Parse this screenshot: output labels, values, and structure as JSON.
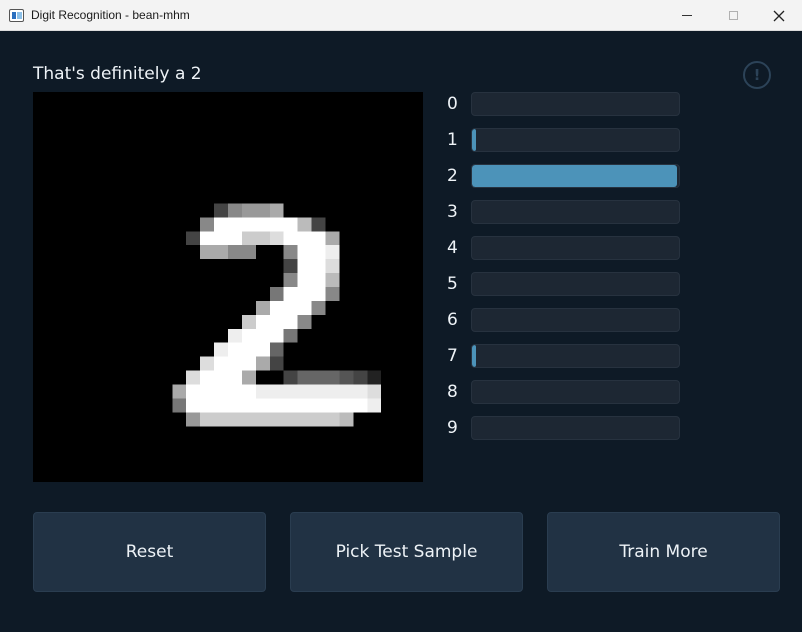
{
  "window": {
    "title": "Digit Recognition - bean-mhm",
    "controls": [
      "minimize-icon",
      "maximize-icon",
      "close-icon"
    ]
  },
  "prediction": {
    "headline": "That's definitely a 2",
    "info_icon": "!"
  },
  "probabilities": [
    {
      "digit": "0",
      "value": 0.0
    },
    {
      "digit": "1",
      "value": 0.01
    },
    {
      "digit": "2",
      "value": 0.99
    },
    {
      "digit": "3",
      "value": 0.0
    },
    {
      "digit": "4",
      "value": 0.0
    },
    {
      "digit": "5",
      "value": 0.0
    },
    {
      "digit": "6",
      "value": 0.0
    },
    {
      "digit": "7",
      "value": 0.01
    },
    {
      "digit": "8",
      "value": 0.0
    },
    {
      "digit": "9",
      "value": 0.0
    }
  ],
  "canvas": {
    "grid_size": 28,
    "pixels": [
      "",
      "",
      "",
      "",
      "",
      "",
      "",
      "                            ",
      "             4899a          ",
      "            8ffffffb4        ",
      "           4fffccdfffa        ",
      "            aa88  8ffe       ",
      "                  4ffd       ",
      "                  8ffb       ",
      "                 7fff8       ",
      "                afff8        ",
      "               cfff8         ",
      "              efff7          ",
      "             efff6           ",
      "            dfffa4           ",
      "           dfffa  4666542    ",
      "          afffffeeeeeeeed    ",
      "          7fffffffffffffe    ",
      "           9ccccccccccb      ",
      "",
      "",
      "",
      ""
    ]
  },
  "buttons": {
    "reset": "Reset",
    "pick": "Pick Test Sample",
    "train": "Train More"
  }
}
